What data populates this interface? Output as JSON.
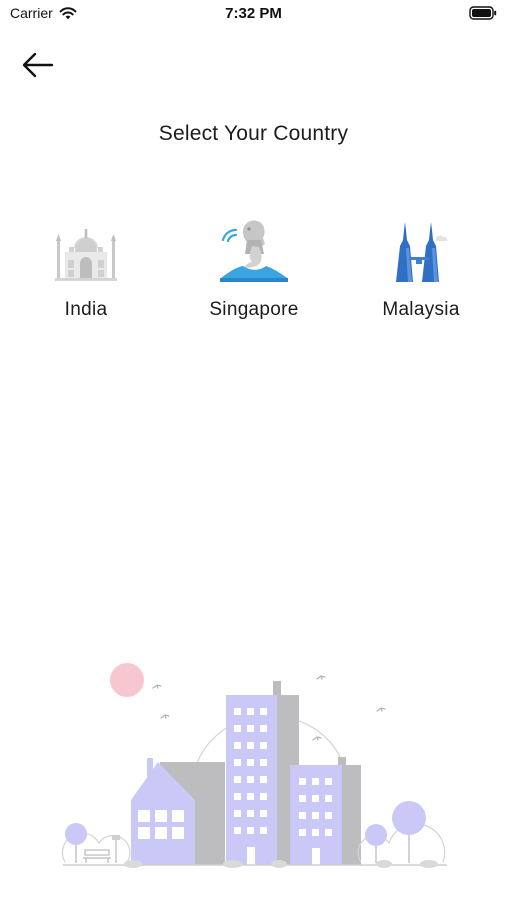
{
  "status_bar": {
    "carrier": "Carrier",
    "time": "7:32 PM",
    "wifi_icon": "wifi-icon",
    "battery_icon": "battery-full-icon"
  },
  "nav": {
    "back_icon": "arrow-left-icon"
  },
  "page_title": "Select Your Country",
  "countries": [
    {
      "label": "India",
      "icon": "taj-mahal-icon"
    },
    {
      "label": "Singapore",
      "icon": "merlion-icon"
    },
    {
      "label": "Malaysia",
      "icon": "petronas-towers-icon"
    }
  ],
  "illustration": "city-skyline-illustration",
  "colors": {
    "background": "#ffffff",
    "text": "#1c1c1c",
    "building_purple": "#c9c8f7",
    "building_gray": "#bdbdc0",
    "sun_pink": "#f8c6cf",
    "merlion_blue": "#3aa5e2",
    "towers_blue": "#2f6fc4"
  }
}
